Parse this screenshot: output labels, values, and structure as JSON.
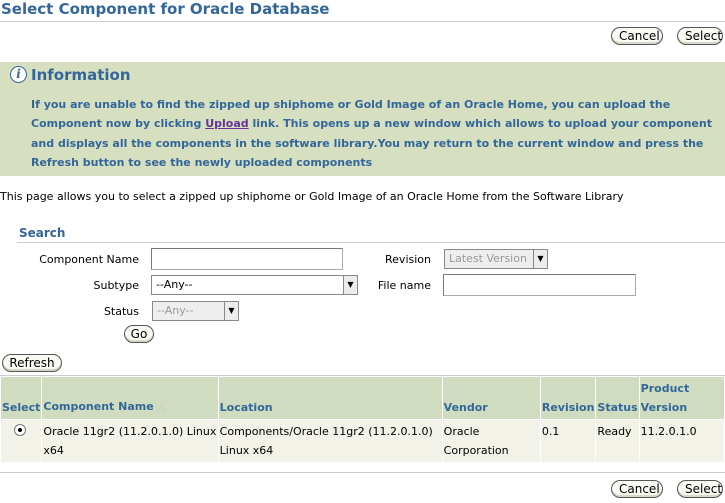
{
  "page": {
    "title": "Select Component for Oracle Database"
  },
  "actions": {
    "cancel_label": "Cancel",
    "select_label": "Select"
  },
  "info": {
    "heading": "Information",
    "text_before": "If you are unable to find the zipped up shiphome or Gold Image of an Oracle Home, you can upload the Component now by clicking ",
    "link": "Upload",
    "text_after": " link. This opens up a new window which allows to upload your component and displays all the components in the software library.You may return to the current window and press the Refresh button to see the newly uploaded components"
  },
  "description": "This page allows you to select a zipped up shiphome or Gold Image of an Oracle Home from the Software Library",
  "search": {
    "heading": "Search",
    "component_name_label": "Component Name",
    "component_name_value": "",
    "subtype_label": "Subtype",
    "subtype_value": "--Any--",
    "status_label": "Status",
    "status_value": "--Any--",
    "revision_label": "Revision",
    "revision_value": "Latest Version",
    "file_name_label": "File name",
    "file_name_value": "",
    "go_label": "Go"
  },
  "refresh_label": "Refresh",
  "table": {
    "headers": {
      "select": "Select",
      "component_name": "Component Name",
      "location": "Location",
      "vendor": "Vendor",
      "revision": "Revision",
      "status": "Status",
      "product_version": "Product Version"
    },
    "rows": [
      {
        "component_name": "Oracle 11gr2 (11.2.0.1.0) Linux x64",
        "location": "Components/Oracle 11gr2 (11.2.0.1.0) Linux x64",
        "vendor": "Oracle Corporation",
        "revision": "0.1",
        "status": "Ready",
        "product_version": "11.2.0.1.0"
      }
    ]
  },
  "icons": {
    "info": "info-icon",
    "sort": "sort-ascending-icon",
    "dropdown": "chevron-down-icon"
  },
  "colors": {
    "heading": "#336699",
    "info_background": "#d6dfc0",
    "table_header": "#cfdcc0",
    "link": "#663399"
  }
}
